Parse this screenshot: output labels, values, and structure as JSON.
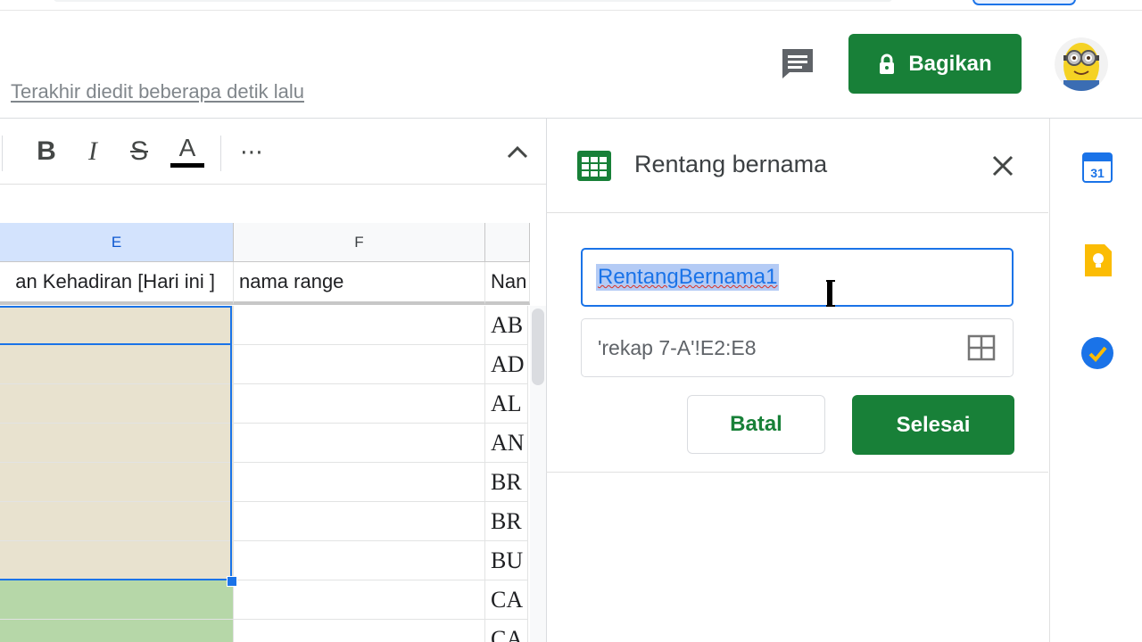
{
  "header": {
    "last_edit": "Terakhir diedit beberapa detik lalu",
    "share_label": "Bagikan"
  },
  "toolbar": {
    "bold": "B",
    "italic": "I",
    "strike": "S",
    "text_color": "A",
    "more": "⋯"
  },
  "grid": {
    "columns": [
      "E",
      "F",
      ""
    ],
    "header_row": [
      "an Kehadiran [Hari ini ]",
      "nama range",
      "Nan"
    ],
    "col_g_values": [
      "AB",
      "AD",
      "AL",
      "AN",
      "BR",
      "BR",
      "BU",
      "CA",
      "CA"
    ]
  },
  "panel": {
    "title": "Rentang bernama",
    "name_value": "RentangBernama1",
    "range_value": "'rekap 7-A'!E2:E8",
    "cancel_label": "Batal",
    "done_label": "Selesai"
  },
  "rail": {
    "calendar_day": "31"
  },
  "colors": {
    "brand_green": "#188038",
    "selection_blue": "#1a73e8",
    "cell_beige": "#e8e2cf",
    "cell_green": "#b6d7a8"
  }
}
